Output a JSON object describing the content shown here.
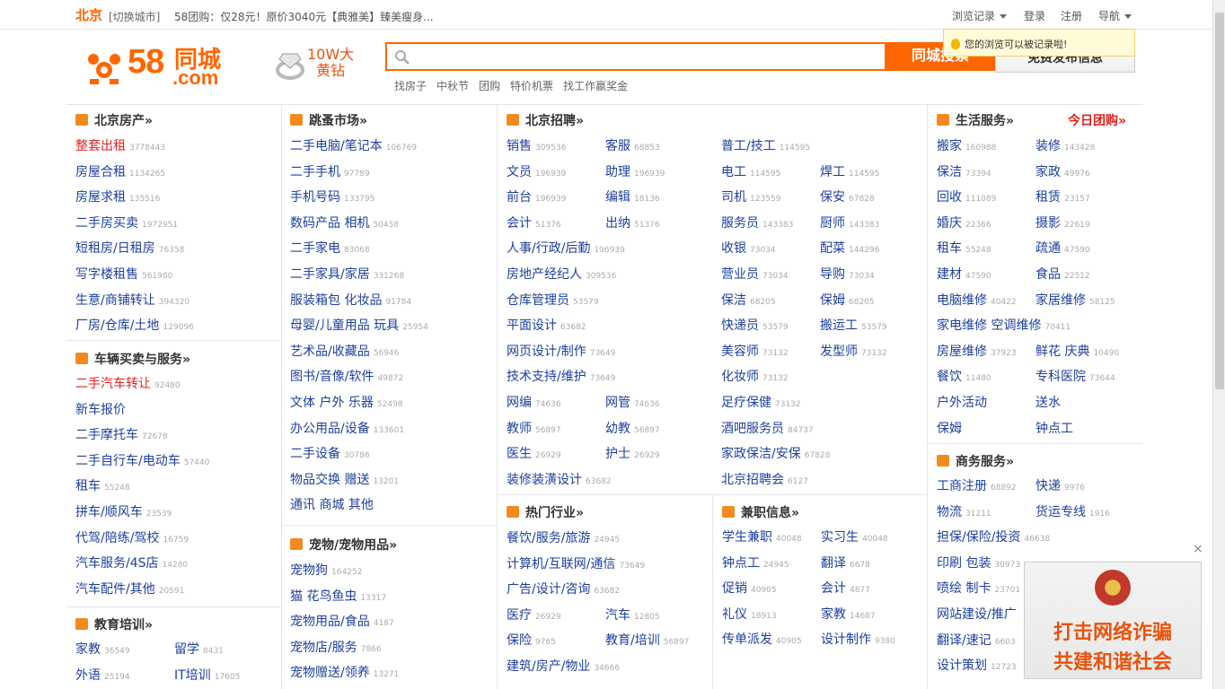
{
  "topbar": {
    "city": "北京",
    "switch_city": "[切换城市]",
    "promo": "58团购：仅28元！原价3040元【典雅美】臻美瘦身...",
    "history": "浏览记录",
    "login": "登录",
    "register": "注册",
    "nav": "导航",
    "tip": "您的浏览可以被记录啦!"
  },
  "header": {
    "logo_num": "58",
    "logo_tc": "同城",
    "logo_com": ".com",
    "badge_l1": "10W大",
    "badge_l2": "黄钻",
    "search_value": "",
    "search_button": "同城搜索",
    "publish_button": "免费发布信息",
    "hotwords": [
      "找房子",
      "中秋节",
      "团购",
      "特价机票",
      "找工作嬴奖金"
    ]
  },
  "sections": {
    "house": {
      "title": "北京房产",
      "items": [
        {
          "t": "整套出租",
          "c": "3778443",
          "red": true
        },
        {
          "t": "房屋合租",
          "c": "1134265"
        },
        {
          "t": "房屋求租",
          "c": "135516"
        },
        {
          "t": "二手房买卖",
          "c": "1972951"
        },
        {
          "t": "短租房/日租房",
          "c": "76358"
        },
        {
          "t": "写字楼租售",
          "c": "561980"
        },
        {
          "t": "生意/商铺转让",
          "c": "394320"
        },
        {
          "t": "厂房/仓库/土地",
          "c": "129096"
        }
      ]
    },
    "car": {
      "title": "车辆买卖与服务",
      "items": [
        {
          "t": "二手汽车转让",
          "c": "92480",
          "red": true
        },
        {
          "t": "新车报价",
          "c": ""
        },
        {
          "t": "二手摩托车",
          "c": "72678"
        },
        {
          "t": "二手自行车/电动车",
          "c": "57440"
        },
        {
          "t": "租车",
          "c": "55248"
        },
        {
          "t": "拼车/顺风车",
          "c": "23539"
        },
        {
          "t": "代驾/陪练/驾校",
          "c": "16759"
        },
        {
          "t": "汽车服务/4S店",
          "c": "14280"
        },
        {
          "t": "汽车配件/其他",
          "c": "20591"
        }
      ]
    },
    "edu": {
      "title": "教育培训",
      "items": [
        {
          "t": "家教",
          "c": "36549"
        },
        {
          "t": "留学",
          "c": "8431"
        },
        {
          "t": "外语",
          "c": "25194"
        },
        {
          "t": "IT培训",
          "c": "17605"
        }
      ]
    },
    "market": {
      "title": "跳蚤市场",
      "items": [
        {
          "t": "二手电脑/笔记本",
          "c": "106769"
        },
        {
          "t": "二手手机",
          "c": "97789"
        },
        {
          "t": "手机号码",
          "c": "133795"
        },
        {
          "t": "数码产品 相机",
          "c": "50458"
        },
        {
          "t": "二手家电",
          "c": "83068"
        },
        {
          "t": "二手家具/家居",
          "c": "331268"
        },
        {
          "t": "服装箱包 化妆品",
          "c": "91784"
        },
        {
          "t": "母婴/儿童用品 玩具",
          "c": "25954"
        },
        {
          "t": "艺术品/收藏品",
          "c": "56946"
        },
        {
          "t": "图书/音像/软件",
          "c": "49872"
        },
        {
          "t": "文体 户外 乐器",
          "c": "52498"
        },
        {
          "t": "办公用品/设备",
          "c": "133601"
        },
        {
          "t": "二手设备",
          "c": "30786"
        },
        {
          "t": "物品交换 赠送",
          "c": "13201"
        },
        {
          "t": "通讯 商城 其他",
          "c": ""
        }
      ]
    },
    "pet": {
      "title": "宠物/宠物用品",
      "items": [
        {
          "t": "宠物狗",
          "c": "164252"
        },
        {
          "t": "猫 花鸟鱼虫",
          "c": "13317"
        },
        {
          "t": "宠物用品/食品",
          "c": "4187"
        },
        {
          "t": "宠物店/服务",
          "c": "7866"
        },
        {
          "t": "宠物赠送/领养",
          "c": "13271"
        }
      ]
    },
    "jobs": {
      "title": "北京招聘",
      "items": [
        {
          "t": "销售",
          "c": "309536"
        },
        {
          "t": "客服",
          "c": "68853"
        },
        {
          "t": "普工/技工",
          "c": "114595"
        },
        {
          "t": "文员",
          "c": "196939"
        },
        {
          "t": "助理",
          "c": "196939"
        },
        {
          "t": "电工",
          "c": "114595"
        },
        {
          "t": "焊工",
          "c": "114595"
        },
        {
          "t": "前台",
          "c": "196939"
        },
        {
          "t": "编辑",
          "c": "18136"
        },
        {
          "t": "司机",
          "c": "123559"
        },
        {
          "t": "保安",
          "c": "67828"
        },
        {
          "t": "会计",
          "c": "51376"
        },
        {
          "t": "出纳",
          "c": "51376"
        },
        {
          "t": "服务员",
          "c": "143383"
        },
        {
          "t": "厨师",
          "c": "143383"
        },
        {
          "t": "人事/行政/后勤",
          "c": "196939"
        },
        {
          "t": "收银",
          "c": "73034"
        },
        {
          "t": "配菜",
          "c": "144296"
        },
        {
          "t": "房地产经纪人",
          "c": "309536"
        },
        {
          "t": "营业员",
          "c": "73034"
        },
        {
          "t": "导购",
          "c": "73034"
        },
        {
          "t": "仓库管理员",
          "c": "53579"
        },
        {
          "t": "保洁",
          "c": "68205"
        },
        {
          "t": "保姆",
          "c": "68205"
        },
        {
          "t": "平面设计",
          "c": "63682"
        },
        {
          "t": "快递员",
          "c": "53579"
        },
        {
          "t": "搬运工",
          "c": "53579"
        },
        {
          "t": "网页设计/制作",
          "c": "73649"
        },
        {
          "t": "美容师",
          "c": "73132"
        },
        {
          "t": "发型师",
          "c": "73132"
        },
        {
          "t": "技术支持/维护",
          "c": "73649"
        },
        {
          "t": "化妆师",
          "c": "73132"
        },
        {
          "t": "网编",
          "c": "74636"
        },
        {
          "t": "网管",
          "c": "74636"
        },
        {
          "t": "足疗保健",
          "c": "73132"
        },
        {
          "t": "教师",
          "c": "56897"
        },
        {
          "t": "幼教",
          "c": "56897"
        },
        {
          "t": "酒吧服务员",
          "c": "84737"
        },
        {
          "t": "医生",
          "c": "26929"
        },
        {
          "t": "护士",
          "c": "26929"
        },
        {
          "t": "家政保洁/安保",
          "c": "67828"
        },
        {
          "t": "装修装潢设计",
          "c": "63682"
        },
        {
          "t": "北京招聘会",
          "c": "6127"
        }
      ]
    },
    "industry": {
      "title": "热门行业",
      "items": [
        {
          "t": "餐饮/服务/旅游",
          "c": "24945"
        },
        {
          "t": "计算机/互联网/通信",
          "c": "73649"
        },
        {
          "t": "广告/设计/咨询",
          "c": "63682"
        },
        {
          "t": "医疗",
          "c": "26929"
        },
        {
          "t": "汽车",
          "c": "12805"
        },
        {
          "t": "保险",
          "c": "9765"
        },
        {
          "t": "教育/培训",
          "c": "56897"
        },
        {
          "t": "建筑/房产/物业",
          "c": "34666"
        }
      ]
    },
    "parttime": {
      "title": "兼职信息",
      "items": [
        {
          "t": "学生兼职",
          "c": "40048"
        },
        {
          "t": "实习生",
          "c": "40048"
        },
        {
          "t": "钟点工",
          "c": "24945"
        },
        {
          "t": "翻译",
          "c": "6678"
        },
        {
          "t": "促销",
          "c": "40905"
        },
        {
          "t": "会计",
          "c": "4877"
        },
        {
          "t": "礼仪",
          "c": "18913"
        },
        {
          "t": "家教",
          "c": "14687"
        },
        {
          "t": "传单派发",
          "c": "40905"
        },
        {
          "t": "设计制作",
          "c": "9380"
        }
      ]
    },
    "life": {
      "title": "生活服务",
      "today": "今日团购",
      "items": [
        {
          "t": "搬家",
          "c": "160988"
        },
        {
          "t": "装修",
          "c": "143428"
        },
        {
          "t": "保洁",
          "c": "73394"
        },
        {
          "t": "家政",
          "c": "49976"
        },
        {
          "t": "回收",
          "c": "111089"
        },
        {
          "t": "租赁",
          "c": "23157"
        },
        {
          "t": "婚庆",
          "c": "22366"
        },
        {
          "t": "摄影",
          "c": "22619"
        },
        {
          "t": "租车",
          "c": "55248"
        },
        {
          "t": "疏通",
          "c": "47590"
        },
        {
          "t": "建材",
          "c": "47590"
        },
        {
          "t": "食品",
          "c": "22512"
        },
        {
          "t": "电脑维修",
          "c": "40422"
        },
        {
          "t": "家居维修",
          "c": "58125"
        },
        {
          "t": "家电维修 空调维修",
          "c": "70411"
        },
        {
          "t": "房屋维修",
          "c": "37923"
        },
        {
          "t": "鲜花 庆典",
          "c": "10490"
        },
        {
          "t": "餐饮",
          "c": "11480"
        },
        {
          "t": "专科医院",
          "c": "73644"
        },
        {
          "t": "户外活动",
          "c": ""
        },
        {
          "t": "送水",
          "c": ""
        },
        {
          "t": "保姆",
          "c": ""
        },
        {
          "t": "钟点工",
          "c": ""
        }
      ]
    },
    "biz": {
      "title": "商务服务",
      "items": [
        {
          "t": "工商注册",
          "c": "68892"
        },
        {
          "t": "快递",
          "c": "9976"
        },
        {
          "t": "物流",
          "c": "31211"
        },
        {
          "t": "货运专线",
          "c": "1916"
        },
        {
          "t": "担保/保险/投资",
          "c": "46638"
        },
        {
          "t": "印刷 包装",
          "c": "30973"
        },
        {
          "t": "喷绘 制卡",
          "c": "23701"
        },
        {
          "t": "网站建设/推广",
          "c": ""
        },
        {
          "t": "翻译/速记",
          "c": "6603"
        },
        {
          "t": "设计策划",
          "c": "12723"
        }
      ]
    }
  },
  "ad": {
    "line1": "打击网络诈骗",
    "line2": "共建和谐社会",
    "close": "×"
  }
}
